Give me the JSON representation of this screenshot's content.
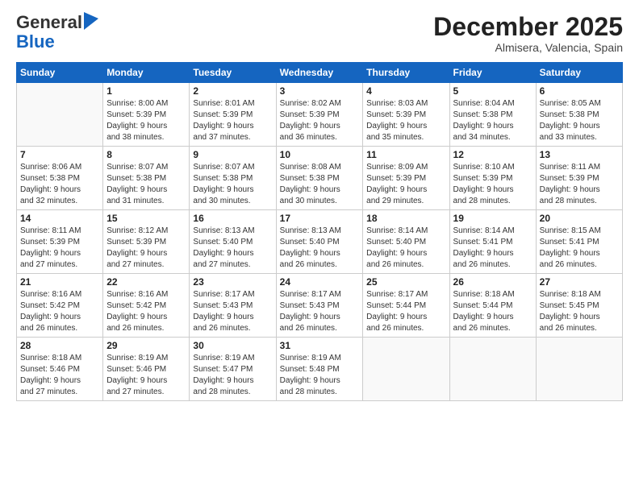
{
  "logo": {
    "general": "General",
    "blue": "Blue"
  },
  "header": {
    "month": "December 2025",
    "location": "Almisera, Valencia, Spain"
  },
  "weekdays": [
    "Sunday",
    "Monday",
    "Tuesday",
    "Wednesday",
    "Thursday",
    "Friday",
    "Saturday"
  ],
  "weeks": [
    [
      {
        "day": "",
        "info": ""
      },
      {
        "day": "1",
        "info": "Sunrise: 8:00 AM\nSunset: 5:39 PM\nDaylight: 9 hours\nand 38 minutes."
      },
      {
        "day": "2",
        "info": "Sunrise: 8:01 AM\nSunset: 5:39 PM\nDaylight: 9 hours\nand 37 minutes."
      },
      {
        "day": "3",
        "info": "Sunrise: 8:02 AM\nSunset: 5:39 PM\nDaylight: 9 hours\nand 36 minutes."
      },
      {
        "day": "4",
        "info": "Sunrise: 8:03 AM\nSunset: 5:39 PM\nDaylight: 9 hours\nand 35 minutes."
      },
      {
        "day": "5",
        "info": "Sunrise: 8:04 AM\nSunset: 5:38 PM\nDaylight: 9 hours\nand 34 minutes."
      },
      {
        "day": "6",
        "info": "Sunrise: 8:05 AM\nSunset: 5:38 PM\nDaylight: 9 hours\nand 33 minutes."
      }
    ],
    [
      {
        "day": "7",
        "info": "Sunrise: 8:06 AM\nSunset: 5:38 PM\nDaylight: 9 hours\nand 32 minutes."
      },
      {
        "day": "8",
        "info": "Sunrise: 8:07 AM\nSunset: 5:38 PM\nDaylight: 9 hours\nand 31 minutes."
      },
      {
        "day": "9",
        "info": "Sunrise: 8:07 AM\nSunset: 5:38 PM\nDaylight: 9 hours\nand 30 minutes."
      },
      {
        "day": "10",
        "info": "Sunrise: 8:08 AM\nSunset: 5:38 PM\nDaylight: 9 hours\nand 30 minutes."
      },
      {
        "day": "11",
        "info": "Sunrise: 8:09 AM\nSunset: 5:39 PM\nDaylight: 9 hours\nand 29 minutes."
      },
      {
        "day": "12",
        "info": "Sunrise: 8:10 AM\nSunset: 5:39 PM\nDaylight: 9 hours\nand 28 minutes."
      },
      {
        "day": "13",
        "info": "Sunrise: 8:11 AM\nSunset: 5:39 PM\nDaylight: 9 hours\nand 28 minutes."
      }
    ],
    [
      {
        "day": "14",
        "info": "Sunrise: 8:11 AM\nSunset: 5:39 PM\nDaylight: 9 hours\nand 27 minutes."
      },
      {
        "day": "15",
        "info": "Sunrise: 8:12 AM\nSunset: 5:39 PM\nDaylight: 9 hours\nand 27 minutes."
      },
      {
        "day": "16",
        "info": "Sunrise: 8:13 AM\nSunset: 5:40 PM\nDaylight: 9 hours\nand 27 minutes."
      },
      {
        "day": "17",
        "info": "Sunrise: 8:13 AM\nSunset: 5:40 PM\nDaylight: 9 hours\nand 26 minutes."
      },
      {
        "day": "18",
        "info": "Sunrise: 8:14 AM\nSunset: 5:40 PM\nDaylight: 9 hours\nand 26 minutes."
      },
      {
        "day": "19",
        "info": "Sunrise: 8:14 AM\nSunset: 5:41 PM\nDaylight: 9 hours\nand 26 minutes."
      },
      {
        "day": "20",
        "info": "Sunrise: 8:15 AM\nSunset: 5:41 PM\nDaylight: 9 hours\nand 26 minutes."
      }
    ],
    [
      {
        "day": "21",
        "info": "Sunrise: 8:16 AM\nSunset: 5:42 PM\nDaylight: 9 hours\nand 26 minutes."
      },
      {
        "day": "22",
        "info": "Sunrise: 8:16 AM\nSunset: 5:42 PM\nDaylight: 9 hours\nand 26 minutes."
      },
      {
        "day": "23",
        "info": "Sunrise: 8:17 AM\nSunset: 5:43 PM\nDaylight: 9 hours\nand 26 minutes."
      },
      {
        "day": "24",
        "info": "Sunrise: 8:17 AM\nSunset: 5:43 PM\nDaylight: 9 hours\nand 26 minutes."
      },
      {
        "day": "25",
        "info": "Sunrise: 8:17 AM\nSunset: 5:44 PM\nDaylight: 9 hours\nand 26 minutes."
      },
      {
        "day": "26",
        "info": "Sunrise: 8:18 AM\nSunset: 5:44 PM\nDaylight: 9 hours\nand 26 minutes."
      },
      {
        "day": "27",
        "info": "Sunrise: 8:18 AM\nSunset: 5:45 PM\nDaylight: 9 hours\nand 26 minutes."
      }
    ],
    [
      {
        "day": "28",
        "info": "Sunrise: 8:18 AM\nSunset: 5:46 PM\nDaylight: 9 hours\nand 27 minutes."
      },
      {
        "day": "29",
        "info": "Sunrise: 8:19 AM\nSunset: 5:46 PM\nDaylight: 9 hours\nand 27 minutes."
      },
      {
        "day": "30",
        "info": "Sunrise: 8:19 AM\nSunset: 5:47 PM\nDaylight: 9 hours\nand 28 minutes."
      },
      {
        "day": "31",
        "info": "Sunrise: 8:19 AM\nSunset: 5:48 PM\nDaylight: 9 hours\nand 28 minutes."
      },
      {
        "day": "",
        "info": ""
      },
      {
        "day": "",
        "info": ""
      },
      {
        "day": "",
        "info": ""
      }
    ]
  ]
}
